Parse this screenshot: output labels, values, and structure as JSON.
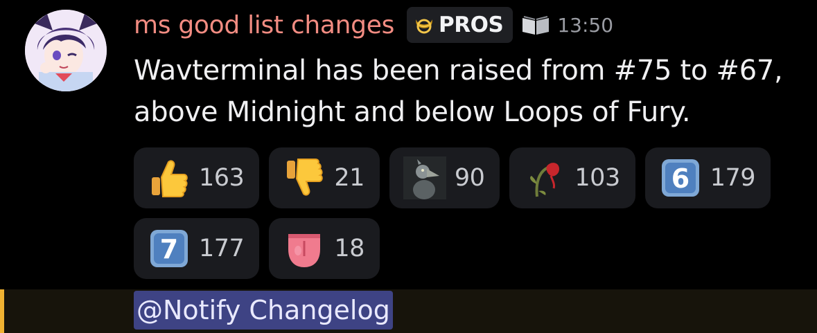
{
  "message": {
    "author": "ms good list changes",
    "server_tag": {
      "icon": "crescent-moon-icon",
      "label": "PROS"
    },
    "badge_icon": "open-book-icon",
    "timestamp": "13:50",
    "text": "Wavterminal has been raised from #75 to #67, above Midnight and below Loops of Fury.",
    "mention": "@Notify Changelog"
  },
  "reactions": [
    {
      "emoji": "thumbs-up-icon",
      "count": "163"
    },
    {
      "emoji": "thumbs-down-icon",
      "count": "21"
    },
    {
      "emoji": "shoebill-bird-icon",
      "count": "90"
    },
    {
      "emoji": "wilted-rose-icon",
      "count": "103"
    },
    {
      "emoji": "keycap-6-icon",
      "count": "179"
    },
    {
      "emoji": "keycap-7-icon",
      "count": "177"
    },
    {
      "emoji": "tongue-icon",
      "count": "18"
    }
  ],
  "colors": {
    "author": "#f28c82",
    "mention_highlight": "#3e4384",
    "mention_stripe": "#f0b232"
  }
}
